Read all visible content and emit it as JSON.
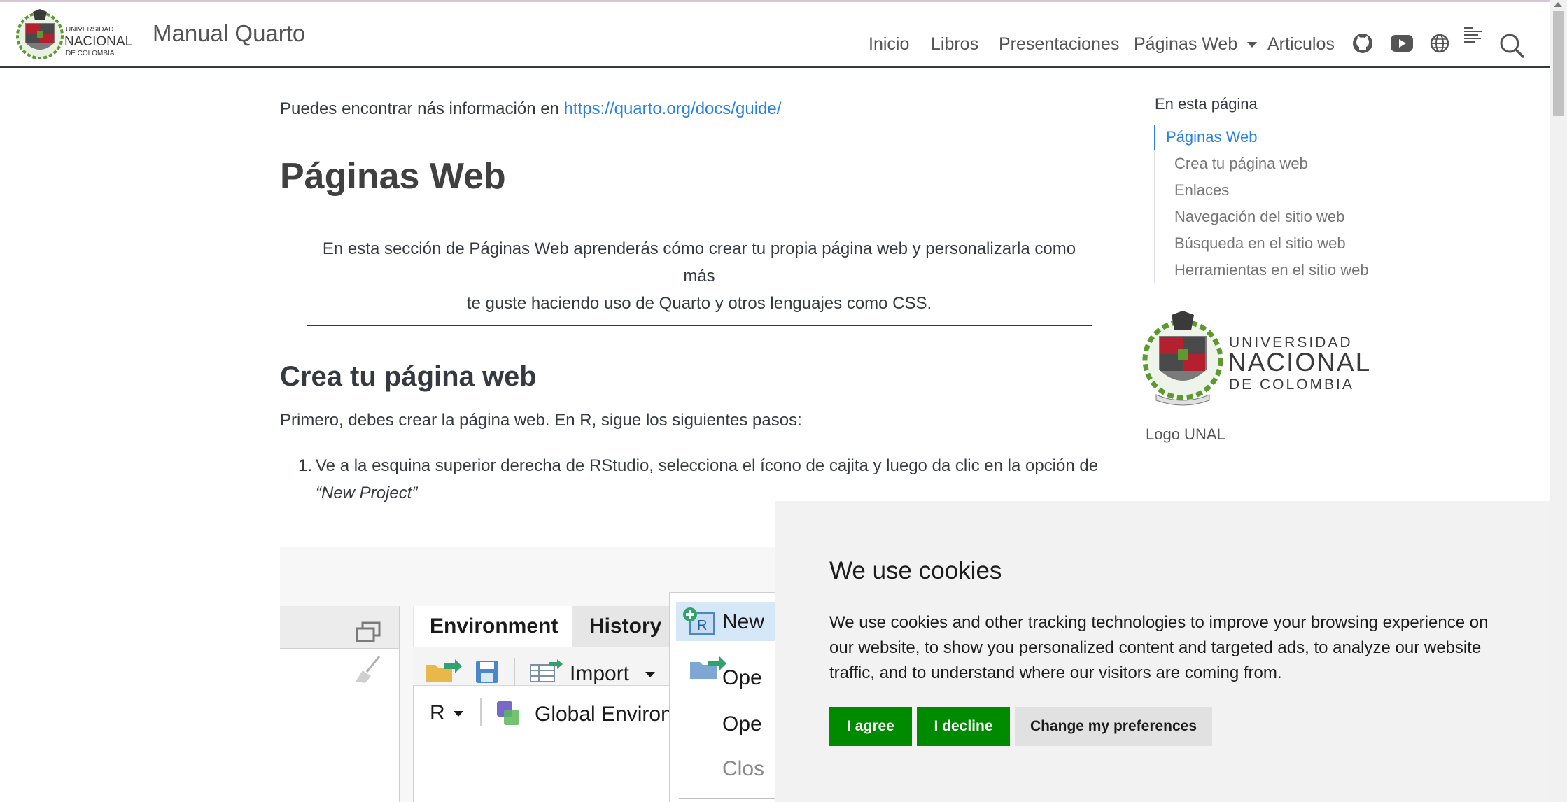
{
  "navbar": {
    "title": "Manual Quarto",
    "logo_text_small": "UNIVERSIDAD",
    "logo_text_big": "NACIONAL",
    "logo_text_sub": "DE COLOMBIA",
    "items": [
      "Inicio",
      "Libros",
      "Presentaciones",
      "Páginas Web",
      "Articulos"
    ],
    "icons": [
      "github-icon",
      "youtube-icon",
      "globe-icon",
      "paper-icon",
      "search-icon"
    ]
  },
  "main": {
    "intro_prefix": "Puedes encontrar nás información en ",
    "intro_link": "https://quarto.org/docs/guide/",
    "title": "Páginas Web",
    "abstract_line1": "En esta sección de Páginas Web aprenderás cómo crear tu propia página web y personalizarla como más",
    "abstract_line2": "te guste haciendo uso de Quarto y otros lenguajes como CSS.",
    "section_title": "Crea tu página web",
    "section_intro": "Primero, debes crear la página web. En R, sigue los siguientes pasos:",
    "list_item_number": "1.",
    "list_item_line1": "Ve a la esquina superior derecha de RStudio, selecciona el ícono de cajita y luego da clic en la opción de",
    "list_item_line2": "“New Project”"
  },
  "toc": {
    "title": "En esta página",
    "items": [
      "Páginas Web",
      "Crea tu página web",
      "Enlaces",
      "Navegación del sitio web",
      "Búsqueda en el sitio web",
      "Herramientas en el sitio web"
    ],
    "logo_caption": "Logo UNAL",
    "logo_text_small": "UNIVERSIDAD",
    "logo_text_big": "NACIONAL",
    "logo_text_sub": "DE COLOMBIA"
  },
  "rstudio": {
    "tab_environment": "Environment",
    "tab_history": "History",
    "import_label": "Import",
    "r_label": "R",
    "global_env": "Global Environ",
    "menu_new": "New",
    "menu_open1": "Ope",
    "menu_open2": "Ope",
    "menu_close": "Clos"
  },
  "cookie": {
    "title": "We use cookies",
    "text": "We use cookies and other tracking technologies to improve your browsing experience on our website, to show you personalized content and targeted ads, to analyze our website traffic, and to understand where our visitors are coming from.",
    "agree": "I agree",
    "decline": "I decline",
    "preferences": "Change my preferences"
  },
  "colors": {
    "link": "#2780e3",
    "accept_green": "#008a00",
    "unal_red": "#b5202e",
    "unal_green": "#5b9a2f"
  }
}
